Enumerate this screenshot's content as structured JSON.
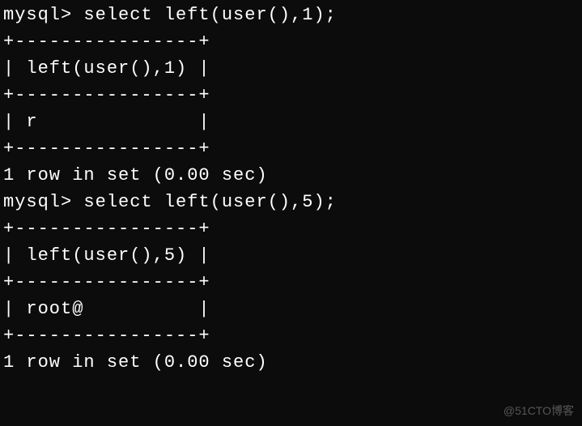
{
  "terminal": {
    "lines": [
      "mysql> select left(user(),1);",
      "+----------------+",
      "| left(user(),1) |",
      "+----------------+",
      "| r              |",
      "+----------------+",
      "1 row in set (0.00 sec)",
      "",
      "mysql> select left(user(),5);",
      "+----------------+",
      "| left(user(),5) |",
      "+----------------+",
      "| root@          |",
      "+----------------+",
      "1 row in set (0.00 sec)"
    ]
  },
  "watermark": "@51CTO博客"
}
